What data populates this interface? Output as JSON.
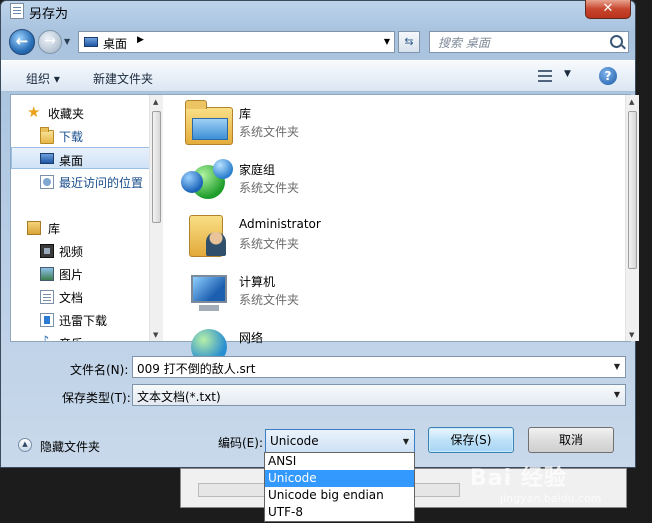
{
  "window": {
    "title": "另存为",
    "close_label": "✕"
  },
  "nav": {
    "address": "桌面",
    "search_placeholder": "搜索 桌面"
  },
  "toolbar": {
    "organize": "组织 ▾",
    "new_folder": "新建文件夹"
  },
  "sidebar": {
    "items": [
      {
        "label": "收藏夹"
      },
      {
        "label": "下载"
      },
      {
        "label": "桌面"
      },
      {
        "label": "最近访问的位置"
      },
      {
        "label": "库"
      },
      {
        "label": "视频"
      },
      {
        "label": "图片"
      },
      {
        "label": "文档"
      },
      {
        "label": "迅雷下载"
      },
      {
        "label": "音乐"
      }
    ]
  },
  "files": [
    {
      "name": "库",
      "type": "系统文件夹",
      "icon": "library-icon"
    },
    {
      "name": "家庭组",
      "type": "系统文件夹",
      "icon": "homegroup-icon"
    },
    {
      "name": "Administrator",
      "type": "系统文件夹",
      "icon": "user-folder-icon"
    },
    {
      "name": "计算机",
      "type": "系统文件夹",
      "icon": "computer-icon"
    },
    {
      "name": "网络",
      "type": "",
      "icon": "network-icon"
    }
  ],
  "form": {
    "filename_label": "文件名(N):",
    "filename_value": "009 打不倒的敌人.srt",
    "filetype_label": "保存类型(T):",
    "filetype_value": "文本文档(*.txt)",
    "hide_folders": "隐藏文件夹",
    "encoding_label": "编码(E):",
    "encoding_value": "Unicode",
    "encoding_options": [
      "ANSI",
      "Unicode",
      "Unicode big endian",
      "UTF-8"
    ],
    "save": "保存(S)",
    "cancel": "取消"
  },
  "watermark": {
    "brand": "Bai 经验",
    "url": "jingyan.baidu.com"
  }
}
